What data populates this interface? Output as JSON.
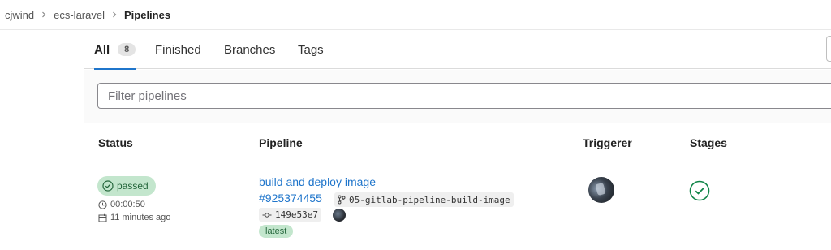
{
  "breadcrumb": {
    "items": [
      "cjwind",
      "ecs-laravel"
    ],
    "current": "Pipelines"
  },
  "tabs": [
    {
      "label": "All",
      "count": "8"
    },
    {
      "label": "Finished"
    },
    {
      "label": "Branches"
    },
    {
      "label": "Tags"
    }
  ],
  "filter": {
    "placeholder": "Filter pipelines",
    "value": ""
  },
  "table": {
    "headers": [
      "Status",
      "Pipeline",
      "Triggerer",
      "Stages"
    ],
    "rows": [
      {
        "status": "passed",
        "duration": "00:00:50",
        "finished": "11 minutes ago",
        "pipeline_name": "build and deploy image",
        "pipeline_id": "#925374455",
        "ref": "05-gitlab-pipeline-build-image",
        "commit": "149e53e7",
        "tag": "latest"
      }
    ]
  },
  "colors": {
    "accent": "#1f75cb",
    "success": "#108548",
    "success_bg": "#c3e6cd"
  }
}
